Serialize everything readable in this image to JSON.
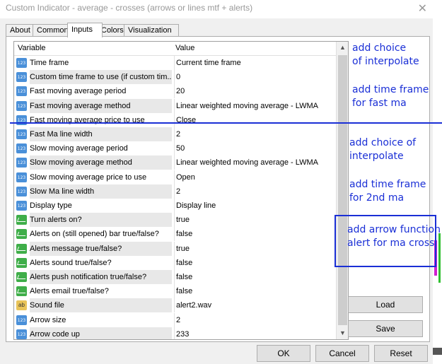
{
  "window": {
    "title": "Custom Indicator - average - crosses (arrows or lines mtf + alerts)",
    "close_glyph": "✕"
  },
  "tabs": [
    {
      "label": "About"
    },
    {
      "label": "Common"
    },
    {
      "label": "Inputs"
    },
    {
      "label": "Colors"
    },
    {
      "label": "Visualization"
    }
  ],
  "grid": {
    "headers": {
      "variable": "Variable",
      "value": "Value"
    },
    "rows": [
      {
        "icon": "numeric-icon",
        "variable": "Time frame",
        "value": "Current time frame"
      },
      {
        "icon": "numeric-icon",
        "variable": "Custom time frame to use (if custom tim...",
        "value": "0"
      },
      {
        "icon": "numeric-icon",
        "variable": "Fast moving average period",
        "value": "20"
      },
      {
        "icon": "numeric-icon",
        "variable": "Fast moving average method",
        "value": "Linear weighted moving average - LWMA"
      },
      {
        "icon": "numeric-icon",
        "variable": "Fast moving average price to use",
        "value": "Close"
      },
      {
        "icon": "numeric-icon",
        "variable": "Fast Ma line width",
        "value": "2"
      },
      {
        "icon": "numeric-icon",
        "variable": "Slow moving average period",
        "value": "50"
      },
      {
        "icon": "numeric-icon",
        "variable": "Slow moving average method",
        "value": "Linear weighted moving average - LWMA"
      },
      {
        "icon": "numeric-icon",
        "variable": "Slow moving average price to use",
        "value": "Open"
      },
      {
        "icon": "numeric-icon",
        "variable": "Slow Ma line width",
        "value": "2"
      },
      {
        "icon": "numeric-icon",
        "variable": "Display type",
        "value": "Display line"
      },
      {
        "icon": "boolean-icon",
        "variable": "Turn alerts on?",
        "value": "true"
      },
      {
        "icon": "boolean-icon",
        "variable": "Alerts on (still opened) bar true/false?",
        "value": "false"
      },
      {
        "icon": "boolean-icon",
        "variable": "Alerts message true/false?",
        "value": "true"
      },
      {
        "icon": "boolean-icon",
        "variable": "Alerts sound true/false?",
        "value": "false"
      },
      {
        "icon": "boolean-icon",
        "variable": "Alerts push notification true/false?",
        "value": "false"
      },
      {
        "icon": "boolean-icon",
        "variable": "Alerts email true/false?",
        "value": "false"
      },
      {
        "icon": "string-icon",
        "variable": "Sound file",
        "value": "alert2.wav"
      },
      {
        "icon": "numeric-icon",
        "variable": "Arrow size",
        "value": "2"
      },
      {
        "icon": "numeric-icon",
        "variable": "Arrow code up",
        "value": "233"
      }
    ]
  },
  "side_buttons": {
    "load": "Load",
    "save": "Save"
  },
  "footer_buttons": {
    "ok": "OK",
    "cancel": "Cancel",
    "reset": "Reset"
  },
  "annotations": {
    "a1_line1": "add choice",
    "a1_line2": "of interpolate",
    "a2_line1": "add time frame",
    "a2_line2": "for fast ma",
    "a3_line1": "add choice of",
    "a3_line2": "interpolate",
    "a4_line1": "add time frame",
    "a4_line2": "for 2nd ma",
    "a5_line1": "add arrow function",
    "a5_line2": "alert for ma cross"
  },
  "colors": {
    "annotation": "#1a2fd6",
    "window_bg": "#f0f0f0"
  }
}
